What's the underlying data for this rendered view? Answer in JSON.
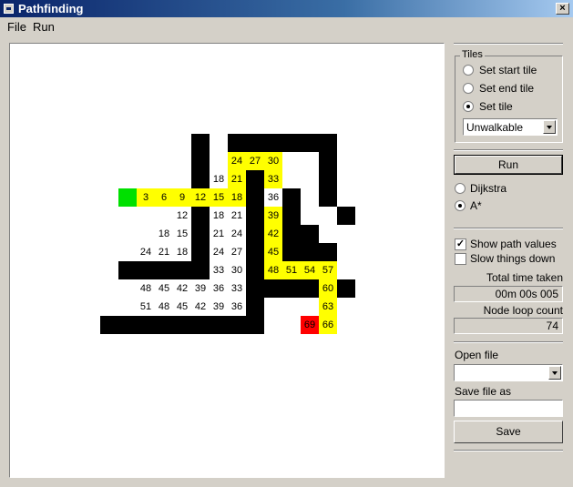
{
  "window": {
    "title": "Pathfinding",
    "close_label": "×"
  },
  "menu": [
    {
      "label": "File"
    },
    {
      "label": "Run"
    }
  ],
  "tiles": {
    "legend": "Tiles",
    "options": [
      "Set start tile",
      "Set end tile",
      "Set tile"
    ],
    "selected_index": 2,
    "tile_type": "Unwalkable"
  },
  "run_label": "Run",
  "algorithms": {
    "options": [
      "Dijkstra",
      "A*"
    ],
    "selected_index": 1
  },
  "options": {
    "show_path_values": {
      "label": "Show path values",
      "checked": true
    },
    "slow_things_down": {
      "label": "Slow things down",
      "checked": false
    }
  },
  "stats": {
    "total_time_label": "Total time taken",
    "total_time_value": "00m 00s 005",
    "loop_count_label": "Node loop count",
    "loop_count_value": "74"
  },
  "open_file": {
    "label": "Open file",
    "value": ""
  },
  "save_file": {
    "label": "Save file as",
    "value": "",
    "button": "Save"
  },
  "grid": {
    "walls": [
      [
        10,
        5
      ],
      [
        12,
        5
      ],
      [
        13,
        5
      ],
      [
        14,
        5
      ],
      [
        15,
        5
      ],
      [
        16,
        5
      ],
      [
        17,
        5
      ],
      [
        10,
        6
      ],
      [
        17,
        6
      ],
      [
        10,
        7
      ],
      [
        13,
        7
      ],
      [
        17,
        7
      ],
      [
        13,
        8
      ],
      [
        15,
        8
      ],
      [
        17,
        8
      ],
      [
        10,
        9
      ],
      [
        13,
        9
      ],
      [
        15,
        9
      ],
      [
        18,
        9
      ],
      [
        10,
        10
      ],
      [
        13,
        10
      ],
      [
        15,
        10
      ],
      [
        16,
        10
      ],
      [
        10,
        11
      ],
      [
        13,
        11
      ],
      [
        15,
        11
      ],
      [
        16,
        11
      ],
      [
        17,
        11
      ],
      [
        6,
        12
      ],
      [
        7,
        12
      ],
      [
        8,
        12
      ],
      [
        9,
        12
      ],
      [
        10,
        12
      ],
      [
        13,
        12
      ],
      [
        13,
        13
      ],
      [
        14,
        13
      ],
      [
        15,
        13
      ],
      [
        16,
        13
      ],
      [
        18,
        13
      ],
      [
        13,
        14
      ],
      [
        5,
        15
      ],
      [
        6,
        15
      ],
      [
        7,
        15
      ],
      [
        8,
        15
      ],
      [
        9,
        15
      ],
      [
        10,
        15
      ],
      [
        11,
        15
      ],
      [
        12,
        15
      ],
      [
        13,
        15
      ]
    ],
    "path": [
      [
        12,
        6
      ],
      [
        13,
        6
      ],
      [
        14,
        6
      ],
      [
        12,
        7
      ],
      [
        14,
        7
      ],
      [
        7,
        8
      ],
      [
        8,
        8
      ],
      [
        9,
        8
      ],
      [
        10,
        8
      ],
      [
        11,
        8
      ],
      [
        12,
        8
      ],
      [
        14,
        9
      ],
      [
        14,
        10
      ],
      [
        14,
        11
      ],
      [
        14,
        12
      ],
      [
        15,
        12
      ],
      [
        16,
        12
      ],
      [
        17,
        12
      ],
      [
        17,
        13
      ],
      [
        17,
        14
      ],
      [
        17,
        15
      ]
    ],
    "start": [
      6,
      8
    ],
    "end": [
      16,
      15
    ],
    "values": [
      {
        "c": 12,
        "r": 6,
        "v": "24"
      },
      {
        "c": 13,
        "r": 6,
        "v": "27"
      },
      {
        "c": 14,
        "r": 6,
        "v": "30"
      },
      {
        "c": 11,
        "r": 7,
        "v": "18"
      },
      {
        "c": 12,
        "r": 7,
        "v": "21"
      },
      {
        "c": 14,
        "r": 7,
        "v": "33"
      },
      {
        "c": 7,
        "r": 8,
        "v": "3"
      },
      {
        "c": 8,
        "r": 8,
        "v": "6"
      },
      {
        "c": 9,
        "r": 8,
        "v": "9"
      },
      {
        "c": 10,
        "r": 8,
        "v": "12"
      },
      {
        "c": 11,
        "r": 8,
        "v": "15"
      },
      {
        "c": 12,
        "r": 8,
        "v": "18"
      },
      {
        "c": 14,
        "r": 8,
        "v": "36"
      },
      {
        "c": 9,
        "r": 9,
        "v": "12"
      },
      {
        "c": 11,
        "r": 9,
        "v": "18"
      },
      {
        "c": 12,
        "r": 9,
        "v": "21"
      },
      {
        "c": 14,
        "r": 9,
        "v": "39"
      },
      {
        "c": 8,
        "r": 10,
        "v": "18"
      },
      {
        "c": 9,
        "r": 10,
        "v": "15"
      },
      {
        "c": 11,
        "r": 10,
        "v": "21"
      },
      {
        "c": 12,
        "r": 10,
        "v": "24"
      },
      {
        "c": 14,
        "r": 10,
        "v": "42"
      },
      {
        "c": 7,
        "r": 11,
        "v": "24"
      },
      {
        "c": 8,
        "r": 11,
        "v": "21"
      },
      {
        "c": 9,
        "r": 11,
        "v": "18"
      },
      {
        "c": 11,
        "r": 11,
        "v": "24"
      },
      {
        "c": 12,
        "r": 11,
        "v": "27"
      },
      {
        "c": 14,
        "r": 11,
        "v": "45"
      },
      {
        "c": 11,
        "r": 12,
        "v": "33"
      },
      {
        "c": 12,
        "r": 12,
        "v": "30"
      },
      {
        "c": 14,
        "r": 12,
        "v": "48"
      },
      {
        "c": 15,
        "r": 12,
        "v": "51"
      },
      {
        "c": 16,
        "r": 12,
        "v": "54"
      },
      {
        "c": 17,
        "r": 12,
        "v": "57"
      },
      {
        "c": 7,
        "r": 13,
        "v": "48"
      },
      {
        "c": 8,
        "r": 13,
        "v": "45"
      },
      {
        "c": 9,
        "r": 13,
        "v": "42"
      },
      {
        "c": 10,
        "r": 13,
        "v": "39"
      },
      {
        "c": 11,
        "r": 13,
        "v": "36"
      },
      {
        "c": 12,
        "r": 13,
        "v": "33"
      },
      {
        "c": 17,
        "r": 13,
        "v": "60"
      },
      {
        "c": 7,
        "r": 14,
        "v": "51"
      },
      {
        "c": 8,
        "r": 14,
        "v": "48"
      },
      {
        "c": 9,
        "r": 14,
        "v": "45"
      },
      {
        "c": 10,
        "r": 14,
        "v": "42"
      },
      {
        "c": 11,
        "r": 14,
        "v": "39"
      },
      {
        "c": 12,
        "r": 14,
        "v": "36"
      },
      {
        "c": 17,
        "r": 14,
        "v": "63"
      },
      {
        "c": 16,
        "r": 15,
        "v": "69"
      },
      {
        "c": 17,
        "r": 15,
        "v": "66"
      }
    ]
  }
}
